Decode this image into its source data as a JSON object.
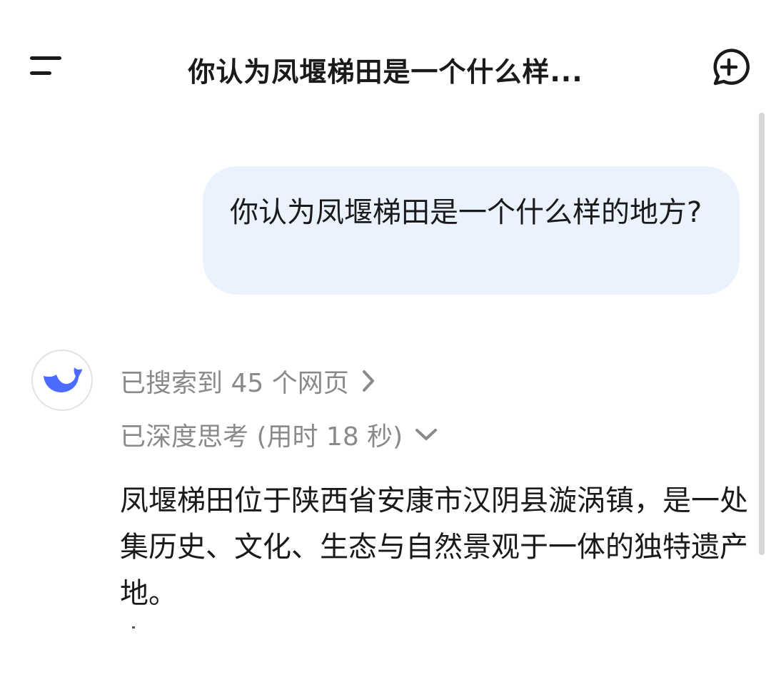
{
  "header": {
    "title": "你认为凤堰梯田是一个什么样...",
    "menu_icon": "menu-icon",
    "new_chat_icon": "new-chat-icon"
  },
  "user_message": {
    "text": "你认为凤堰梯田是一个什么样的地方?"
  },
  "assistant": {
    "avatar_icon": "whale-logo-icon",
    "search_status": "已搜索到 45 个网页",
    "thinking_status": "已深度思考 (用时 18 秒)",
    "answer": "凤堰梯田位于陕西省安康市汉阴县漩涡镇，是一处集历史、文化、生态与自然景观于一体的独特遗产地。"
  },
  "colors": {
    "bubble_bg": "#eaf2fd",
    "brand_blue": "#4d6bfe",
    "muted_text": "#8a8a8a"
  }
}
